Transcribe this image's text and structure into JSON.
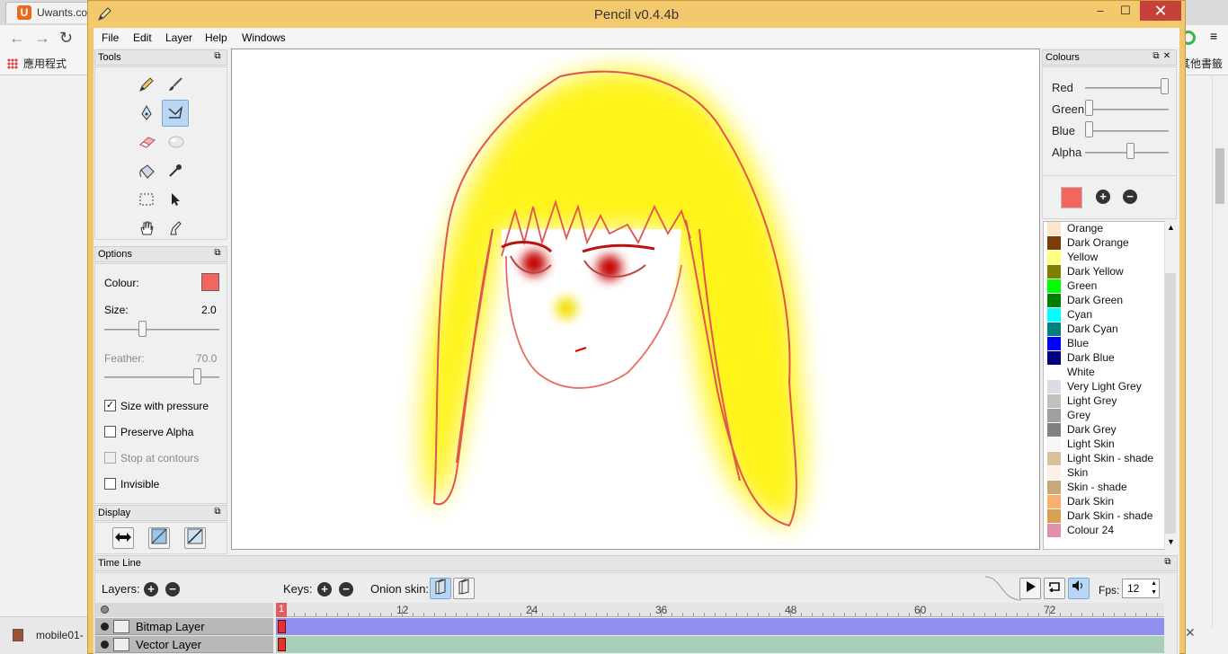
{
  "browser": {
    "tab_title": "Uwants.com",
    "tab_logo": "U",
    "bookmark_apps": "應用程式",
    "bookmark_other": "其他書籤",
    "taskbar_item": "mobile01-"
  },
  "window": {
    "title": "Pencil v0.4.4b",
    "min": "–",
    "max": "☐",
    "close": "✕"
  },
  "menu": [
    "File",
    "Edit",
    "Layer",
    "Help",
    "Windows"
  ],
  "tools_panel": {
    "title": "Tools",
    "tools": [
      {
        "name": "pencil-tool",
        "icon": "pencil-icon"
      },
      {
        "name": "brush-tool",
        "icon": "brush-icon"
      },
      {
        "name": "pen-tool",
        "icon": "pen-nib-icon"
      },
      {
        "name": "polyline-tool",
        "icon": "polyline-icon",
        "active": true
      },
      {
        "name": "eraser-tool",
        "icon": "eraser-icon"
      },
      {
        "name": "smudge-tool",
        "icon": "smudge-icon"
      },
      {
        "name": "bucket-tool",
        "icon": "bucket-icon"
      },
      {
        "name": "eyedropper-tool",
        "icon": "eyedropper-icon"
      },
      {
        "name": "select-tool",
        "icon": "select-rect-icon"
      },
      {
        "name": "move-tool",
        "icon": "arrow-cursor-icon"
      },
      {
        "name": "hand-tool",
        "icon": "hand-icon"
      },
      {
        "name": "clear-tool",
        "icon": "clear-icon"
      }
    ]
  },
  "options_panel": {
    "title": "Options",
    "colour_label": "Colour:",
    "colour": "#f5655f",
    "size_label": "Size:",
    "size_value": "2.0",
    "feather_label": "Feather:",
    "feather_value": "70.0",
    "checkboxes": [
      {
        "label": "Size with pressure",
        "checked": true,
        "enabled": true
      },
      {
        "label": "Preserve Alpha",
        "checked": false,
        "enabled": true
      },
      {
        "label": "Stop at contours",
        "checked": false,
        "enabled": false
      },
      {
        "label": "Invisible",
        "checked": false,
        "enabled": true
      }
    ]
  },
  "display_panel": {
    "title": "Display"
  },
  "colours_panel": {
    "title": "Colours",
    "channels": [
      {
        "label": "Red",
        "value": 1.0
      },
      {
        "label": "Green",
        "value": 0.0
      },
      {
        "label": "Blue",
        "value": 0.0
      },
      {
        "label": "Alpha",
        "value": 0.55
      }
    ],
    "current": "#f5655f",
    "palette": [
      {
        "name": "Orange",
        "color": "#fde4cc"
      },
      {
        "name": "Dark Orange",
        "color": "#7a3c08"
      },
      {
        "name": "Yellow",
        "color": "#ffff80"
      },
      {
        "name": "Dark Yellow",
        "color": "#808000"
      },
      {
        "name": "Green",
        "color": "#00ff00"
      },
      {
        "name": "Dark Green",
        "color": "#008000"
      },
      {
        "name": "Cyan",
        "color": "#00ffff"
      },
      {
        "name": "Dark Cyan",
        "color": "#008080"
      },
      {
        "name": "Blue",
        "color": "#0000ff"
      },
      {
        "name": "Dark Blue",
        "color": "#000080"
      },
      {
        "name": "White",
        "color": "#ffffff"
      },
      {
        "name": "Very Light Grey",
        "color": "#dcdce4"
      },
      {
        "name": "Light Grey",
        "color": "#c0c0c0"
      },
      {
        "name": "Grey",
        "color": "#a0a0a4"
      },
      {
        "name": "Dark Grey",
        "color": "#808080"
      },
      {
        "name": "Light Skin",
        "color": "#f8f4f8"
      },
      {
        "name": "Light Skin - shade",
        "color": "#d8c09a"
      },
      {
        "name": "Skin",
        "color": "#fdf0e4"
      },
      {
        "name": "Skin - shade",
        "color": "#c8a878"
      },
      {
        "name": "Dark Skin",
        "color": "#f8b070"
      },
      {
        "name": "Dark Skin - shade",
        "color": "#d8a050"
      },
      {
        "name": "Colour 24",
        "color": "#e090a8"
      }
    ]
  },
  "timeline": {
    "title": "Time Line",
    "layers_label": "Layers:",
    "keys_label": "Keys:",
    "onion_label": "Onion skin:",
    "fps_label": "Fps:",
    "fps_value": "12",
    "frame_marks": [
      "12",
      "24",
      "36",
      "48",
      "60",
      "72"
    ],
    "layers": [
      {
        "name": "Bitmap Layer",
        "track_color": "#8f8ff0"
      },
      {
        "name": "Vector Layer",
        "track_color": "#a8d0b8"
      }
    ]
  }
}
